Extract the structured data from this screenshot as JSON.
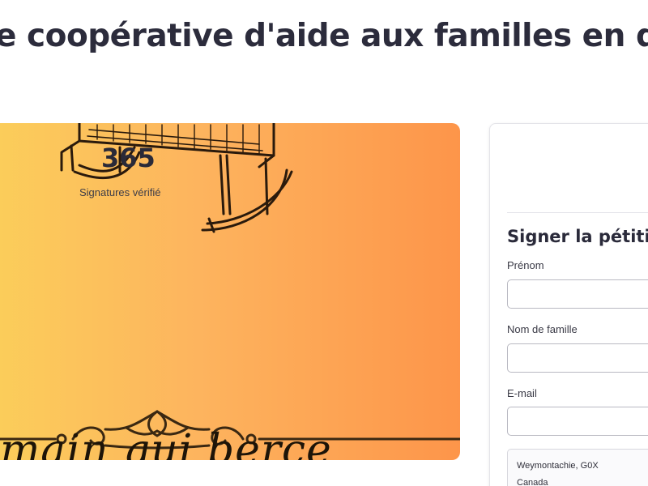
{
  "petition": {
    "title": "e coopérative d'aide aux familles en diffic"
  },
  "hero": {
    "caption": "main qui berce",
    "gradient_colors": [
      "#fbcf5a",
      "#fdb45e",
      "#fd954a"
    ]
  },
  "signatures": {
    "count": "365",
    "label": "Signatures vérifié"
  },
  "sign_form": {
    "heading": "Signer la pétition",
    "first_name_label": "Prénom",
    "last_name_label": "Nom de famille",
    "email_label": "E-mail",
    "first_name_value": "",
    "last_name_value": "",
    "email_value": "",
    "location": {
      "line1": "Weymontachie, G0X",
      "line2": "Canada"
    }
  }
}
